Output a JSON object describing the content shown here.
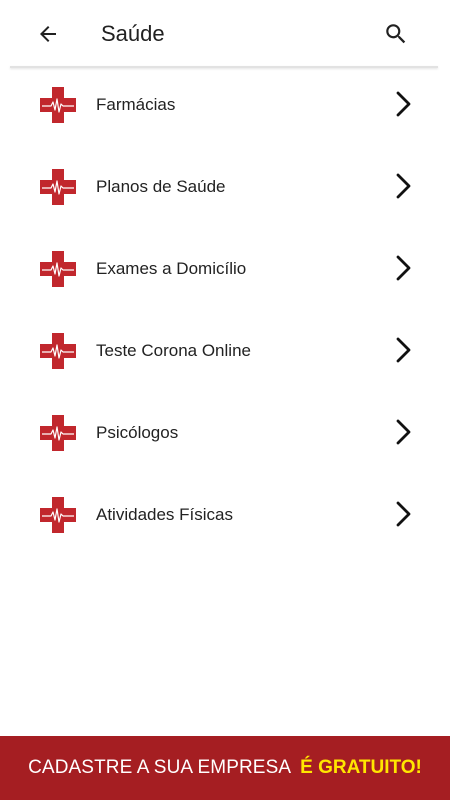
{
  "header": {
    "title": "Saúde",
    "back_icon": "arrow-left-icon",
    "search_icon": "search-icon"
  },
  "list": {
    "items": [
      {
        "label": "Farmácias",
        "icon": "medical-cross-icon"
      },
      {
        "label": "Planos de Saúde",
        "icon": "medical-cross-icon"
      },
      {
        "label": "Exames a Domicílio",
        "icon": "medical-cross-icon"
      },
      {
        "label": "Teste Corona Online",
        "icon": "medical-cross-icon"
      },
      {
        "label": "Psicólogos",
        "icon": "medical-cross-icon"
      },
      {
        "label": "Atividades Físicas",
        "icon": "medical-cross-icon"
      }
    ]
  },
  "banner": {
    "text": "CADASTRE A SUA EMPRESA",
    "highlight": "É GRATUITO!"
  },
  "colors": {
    "brand_red": "#a51e22",
    "cross_red": "#c1272d",
    "highlight_yellow": "#ffe600"
  }
}
